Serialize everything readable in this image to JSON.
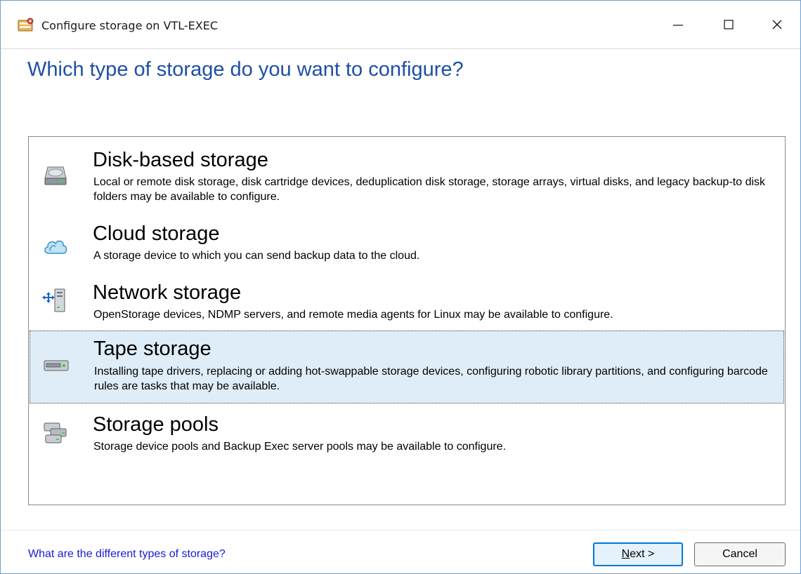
{
  "window": {
    "title": "Configure storage on VTL-EXEC",
    "controls": {
      "minimize_icon": "minimize-icon",
      "maximize_icon": "maximize-icon",
      "close_icon": "close-icon"
    }
  },
  "heading": "Which type of storage do you want to configure?",
  "options": [
    {
      "title": "Disk-based storage",
      "description": "Local or remote disk storage, disk cartridge devices, deduplication disk storage, storage arrays, virtual disks, and legacy backup-to disk folders may be available to configure.",
      "icon": "disk-drive-icon",
      "selected": false
    },
    {
      "title": "Cloud storage",
      "description": "A storage device to which you can send backup data to the cloud.",
      "icon": "cloud-icon",
      "selected": false
    },
    {
      "title": "Network storage",
      "description": "OpenStorage devices, NDMP servers, and remote media agents for Linux may be available to configure.",
      "icon": "network-server-icon",
      "selected": false
    },
    {
      "title": "Tape storage",
      "description": "Installing tape drivers, replacing or adding hot-swappable storage devices, configuring robotic library partitions, and configuring barcode rules are tasks that may be available.",
      "icon": "tape-drive-icon",
      "selected": true
    },
    {
      "title": "Storage pools",
      "description": "Storage device pools and Backup Exec server pools may be available to configure.",
      "icon": "storage-pool-icon",
      "selected": false
    }
  ],
  "footer": {
    "help_link": "What are the different types of storage?",
    "next_mnemonic": "N",
    "next_rest": "ext >",
    "cancel_label": "Cancel"
  },
  "colors": {
    "heading": "#1f4fa6",
    "link": "#1a1ad6",
    "selected_bg": "#deedf8",
    "default_button_border": "#0078d7"
  }
}
